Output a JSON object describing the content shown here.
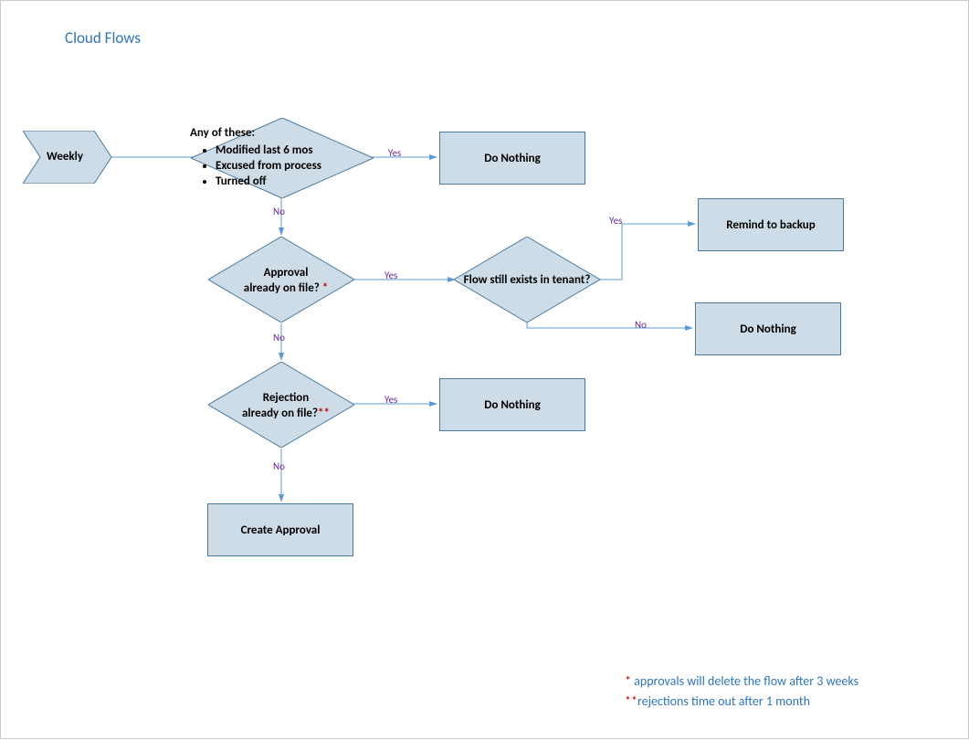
{
  "title": "Cloud Flows",
  "nodes": {
    "start": {
      "label": "Weekly"
    },
    "d1": {
      "heading": "Any of these:",
      "b1": "Modified last 6 mos",
      "b2": "Excused from process",
      "b3": "Turned off"
    },
    "p1": {
      "label": "Do Nothing"
    },
    "d2": {
      "line1": "Approval",
      "line2": "already on file? ",
      "star": "*"
    },
    "d3": {
      "label": "Flow still exists in tenant?"
    },
    "p2": {
      "label": "Remind to backup"
    },
    "p3": {
      "label": "Do Nothing"
    },
    "d4": {
      "line1": "Rejection",
      "line2": "already on file?",
      "star": "**"
    },
    "p4": {
      "label": "Do Nothing"
    },
    "p5": {
      "label": "Create Approval"
    }
  },
  "labels": {
    "yes": "Yes",
    "no": "No"
  },
  "footnotes": {
    "f1_star": "* ",
    "f1_text": "approvals will delete the flow after 3 weeks",
    "f2_star": "**",
    "f2_text": "rejections time out after 1 month"
  }
}
